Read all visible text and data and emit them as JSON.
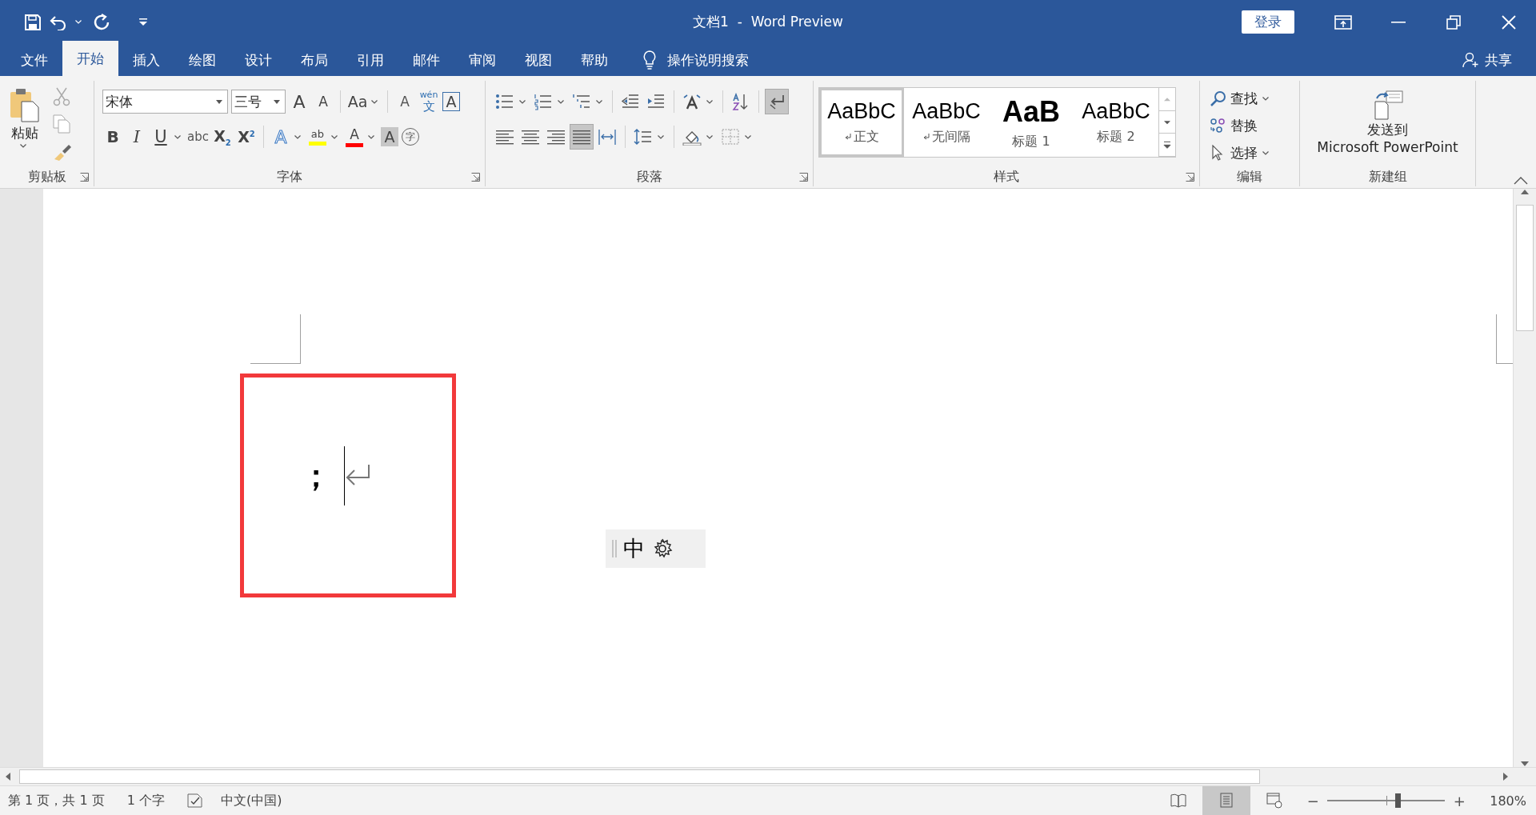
{
  "title_bar": {
    "title": "文档1  -  Word Preview",
    "sign_in": "登录"
  },
  "tabs": [
    {
      "label": "文件",
      "selected": false
    },
    {
      "label": "开始",
      "selected": true
    },
    {
      "label": "插入",
      "selected": false
    },
    {
      "label": "绘图",
      "selected": false
    },
    {
      "label": "设计",
      "selected": false
    },
    {
      "label": "布局",
      "selected": false
    },
    {
      "label": "引用",
      "selected": false
    },
    {
      "label": "邮件",
      "selected": false
    },
    {
      "label": "审阅",
      "selected": false
    },
    {
      "label": "视图",
      "selected": false
    },
    {
      "label": "帮助",
      "selected": false
    }
  ],
  "tell_me": "操作说明搜索",
  "share": "共享",
  "clipboard": {
    "label": "剪贴板",
    "paste": "粘贴"
  },
  "font": {
    "label": "字体",
    "font_name": "宋体",
    "font_size": "三号",
    "row_1": [
      {
        "kind": "grow",
        "label": "A",
        "menu": false
      },
      {
        "kind": "shrink",
        "label": "A",
        "menu": false
      },
      {
        "kind": "case",
        "label": "Aa",
        "menu": true
      },
      {
        "kind": "clear",
        "label": "A",
        "menu": false
      },
      {
        "kind": "phonetic",
        "label": "wén",
        "sub": "文",
        "menu": false
      },
      {
        "kind": "border",
        "label": "A",
        "menu": false
      }
    ],
    "row_2": [
      {
        "kind": "bold",
        "label": "B",
        "menu": false
      },
      {
        "kind": "italic",
        "label": "I",
        "menu": false
      },
      {
        "kind": "underline",
        "label": "U",
        "menu": true
      },
      {
        "kind": "strike",
        "label": "abc",
        "menu": false
      },
      {
        "kind": "subscript",
        "label": "X$_{2}$",
        "menu": false
      },
      {
        "kind": "superscript",
        "label": "X$^{2}$",
        "menu": false
      },
      {
        "kind": "effects",
        "label": "A",
        "menu": true
      },
      {
        "kind": "highlight",
        "label": "ab",
        "menu": true,
        "color": "#ffff00"
      },
      {
        "kind": "color",
        "label": "A",
        "menu": true,
        "color": "#ff0000"
      },
      {
        "kind": "shading",
        "label": "A",
        "menu": false
      },
      {
        "kind": "enclose",
        "label": "字",
        "menu": false
      }
    ]
  },
  "paragraph": {
    "label": "段落",
    "show_marks": {
      "on": true
    },
    "alignment": [
      {
        "kind": "left",
        "selected": false
      },
      {
        "kind": "center",
        "selected": false
      },
      {
        "kind": "right",
        "selected": false
      },
      {
        "kind": "justify",
        "selected": true
      },
      {
        "kind": "distributed",
        "selected": false
      }
    ]
  },
  "styles": {
    "label": "样式",
    "items": [
      {
        "kind": "normal",
        "preview": "AaBbC",
        "name": "正文",
        "selected": true
      },
      {
        "kind": "no-spacing",
        "preview": "AaBbC",
        "name": "无间隔",
        "selected": false
      },
      {
        "kind": "heading1",
        "preview": "AaB",
        "name": "标题 1",
        "selected": false
      },
      {
        "kind": "heading2",
        "preview": "AaBbC",
        "name": "标题 2",
        "selected": false
      }
    ]
  },
  "editing": {
    "label": "编辑",
    "items": [
      {
        "kind": "find",
        "label": "查找",
        "menu": true
      },
      {
        "kind": "replace",
        "label": "替换",
        "menu": false
      },
      {
        "kind": "select",
        "label": "选择",
        "menu": true
      }
    ]
  },
  "new_group": {
    "label": "新建组",
    "send_lines": [
      "发送到",
      "Microsoft PowerPoint"
    ]
  },
  "document": {
    "text": "；"
  },
  "ime": {
    "mode": "中"
  },
  "status_bar": {
    "page": "第 1 页，共 1 页",
    "words": "1 个字",
    "language": "中文(中国)",
    "views": [
      {
        "kind": "read",
        "selected": false
      },
      {
        "kind": "print",
        "selected": true
      },
      {
        "kind": "web",
        "selected": false
      }
    ],
    "zoom": {
      "minus": "−",
      "plus": "+",
      "level": 0.6,
      "percent": "180%"
    }
  }
}
